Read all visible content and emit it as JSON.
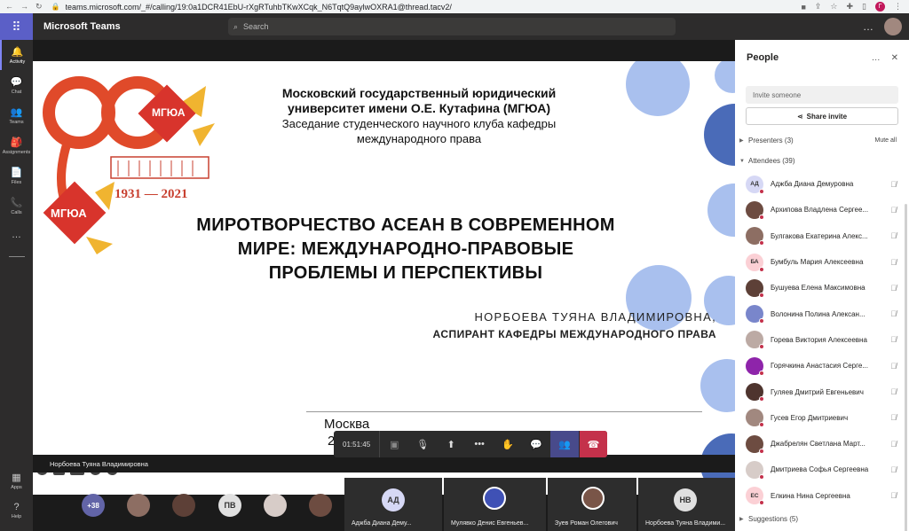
{
  "browser": {
    "url": "teams.microsoft.com/_#/calling/19:0a1DCR41EbU-rXgRTuhbTKwXCqk_N6TqtQ9aylwOXRA1@thread.tacv2/",
    "profile_initial": "Г"
  },
  "app": {
    "name": "Microsoft Teams",
    "search_placeholder": "Search",
    "more": "…"
  },
  "rail": {
    "items": [
      {
        "label": "Activity",
        "icon": "bell-icon",
        "glyph": "🔔"
      },
      {
        "label": "Chat",
        "icon": "chat-icon",
        "glyph": "💬"
      },
      {
        "label": "Teams",
        "icon": "teams-icon",
        "glyph": "👥"
      },
      {
        "label": "Assignments",
        "icon": "assignments-icon",
        "glyph": "🎒"
      },
      {
        "label": "Files",
        "icon": "files-icon",
        "glyph": "📄"
      },
      {
        "label": "Calls",
        "icon": "phone-icon",
        "glyph": "📞"
      }
    ],
    "more": "…",
    "bottom": [
      {
        "label": "Apps",
        "icon": "apps-icon",
        "glyph": "▦"
      },
      {
        "label": "Help",
        "icon": "help-icon",
        "glyph": "?"
      }
    ]
  },
  "slide": {
    "header_line1": "Московский государственный юридический",
    "header_line2": "университет имени О.Е. Кутафина (МГЮА)",
    "header_line3": "Заседание студенческого научного клуба кафедры",
    "header_line4": "международного права",
    "logo_text_top": "МГЮА",
    "logo_text_bottom": "МГЮА",
    "logo_years": "1931 — 2021",
    "title_line1": "МИРОТВОРЧЕСТВО АСЕАН В СОВРЕМЕННОМ",
    "title_line2": "МИРЕ: МЕЖДУНАРОДНО-ПРАВОВЫЕ",
    "title_line3": "ПРОБЛЕМЫ И ПЕРСПЕКТИВЫ",
    "author_name": "НОРБОЕВА ТУЯНА ВЛАДИМИРОВНА,",
    "author_role": "АСПИРАНТ КАФЕДРЫ МЕЖДУНАРОДНОГО ПРАВА",
    "city": "Москва",
    "year_fragment": "2",
    "nav_cc": "CC"
  },
  "presenter_name": "Норбоева Туяна Владимировна",
  "controls": {
    "timer": "01:51:45"
  },
  "gallery": {
    "overflow": "+38",
    "initials_pv": "ПВ",
    "tiles": [
      {
        "initials": "АД",
        "name": "Аджба Диана Дему..."
      },
      {
        "initials": "",
        "name": "Мулявко Денис Евгеньев..."
      },
      {
        "initials": "",
        "name": "Зуев Роман Олегович"
      },
      {
        "initials": "НВ",
        "name": "Норбоева Туяна Владими..."
      }
    ]
  },
  "people": {
    "title": "People",
    "invite_placeholder": "Invite someone",
    "share_label": "Share invite",
    "presenters_label": "Presenters (3)",
    "mute_all": "Mute all",
    "attendees_label": "Attendees (39)",
    "suggestions_label": "Suggestions (5)",
    "attendees": [
      {
        "name": "Аджба Диана Демуровна",
        "initials": "АД",
        "color": "#d6d8f5"
      },
      {
        "name": "Архипова Владлена Сергее...",
        "initials": "",
        "color": "#6d4c41"
      },
      {
        "name": "Булгакова Екатерина Алекс...",
        "initials": "",
        "color": "#8d6e63"
      },
      {
        "name": "Бумбуль Мария Алексеевна",
        "initials": "БА",
        "color": "#fbd0d5"
      },
      {
        "name": "Бушуева Елена Максимовна",
        "initials": "",
        "color": "#5d4037"
      },
      {
        "name": "Волонина Полина Алексан...",
        "initials": "",
        "color": "#7986cb"
      },
      {
        "name": "Горева Виктория Алексеевна",
        "initials": "",
        "color": "#bcaaa4"
      },
      {
        "name": "Горячкина Анастасия Серге...",
        "initials": "",
        "color": "#8e24aa"
      },
      {
        "name": "Гуляев Дмитрий Евгеньевич",
        "initials": "",
        "color": "#4e342e"
      },
      {
        "name": "Гусев Егор Дмитриевич",
        "initials": "",
        "color": "#a1887f"
      },
      {
        "name": "Джабрелян Светлана Март...",
        "initials": "",
        "color": "#6d4c41"
      },
      {
        "name": "Дмитриева Софья Сергеевна",
        "initials": "",
        "color": "#d7ccc8"
      },
      {
        "name": "Елкина Нина Сергеевна",
        "initials": "ЕС",
        "color": "#fbd0d5"
      }
    ]
  }
}
